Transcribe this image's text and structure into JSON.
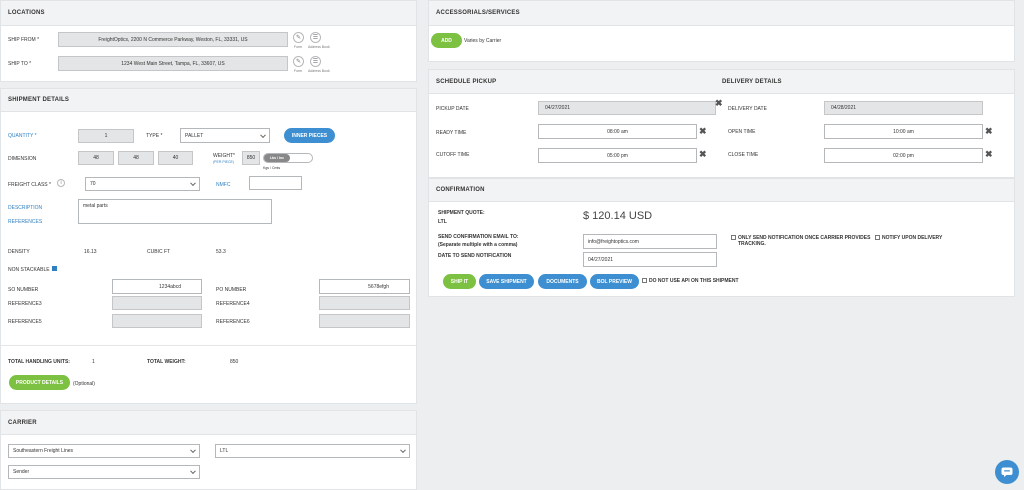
{
  "locations": {
    "title": "LOCATIONS",
    "ship_from_label": "SHIP FROM *",
    "ship_from_value": "FreightOptics, 2200 N Commerce Parkway, Weston, FL, 33331, US",
    "ship_to_label": "SHIP TO *",
    "ship_to_value": "1234 West Main Street, Tampa, FL, 33607, US",
    "form_label": "Form",
    "address_book_label": "Address Book"
  },
  "shipment": {
    "title": "SHIPMENT DETAILS",
    "quantity_label": "QUANTITY *",
    "quantity_value": "1",
    "type_label": "TYPE *",
    "type_value": "PALLET",
    "inner_pieces_button": "INNER PIECES",
    "dimension_label": "DIMENSION",
    "dim_l": "48",
    "dim_w": "48",
    "dim_h": "40",
    "weight_label": "WEIGHT*",
    "weight_sub": "(PER PIECE)",
    "weight_value": "850",
    "weight_unit_toggle": "Lbs / Inc",
    "weight_unit_alt": "Kgs / Cmts",
    "freight_class_label": "FREIGHT CLASS *",
    "freight_class_value": "70",
    "nmfc_label": "NMFC",
    "nmfc_value": "",
    "description_label": "DESCRIPTION",
    "description_value": "metal parts",
    "references_label": "REFERENCES",
    "density_label": "DENSITY",
    "density_value": "16.13",
    "cubic_ft_label": "CUBIC FT",
    "cubic_ft_value": "53.3",
    "non_stackable_label": "NON STACKABLE",
    "so_number_label": "SO NUMBER",
    "so_number_value": "1234abcd",
    "po_number_label": "PO NUMBER",
    "po_number_value": "5678efgh",
    "reference3_label": "REFERENCE3",
    "reference4_label": "REFERENCE4",
    "reference5_label": "REFERENCE5",
    "reference6_label": "REFERENCE6",
    "total_units_label": "TOTAL HANDLING UNITS:",
    "total_units_value": "1",
    "total_weight_label": "TOTAL WEIGHT:",
    "total_weight_value": "850",
    "product_details_button": "PRODUCT DETAILS",
    "optional_label": "(Optional)"
  },
  "carrier": {
    "title": "CARRIER",
    "carrier_value": "Southeastern Freight Lines",
    "mode_value": "LTL",
    "party_value": "Sender"
  },
  "accessorials": {
    "title": "ACCESSORIALS/SERVICES",
    "add_button": "ADD",
    "note": "Varies by Carrier"
  },
  "pickup": {
    "title": "SCHEDULE PICKUP",
    "pickup_date_label": "PICKUP DATE",
    "pickup_date_value": "04/27/2021",
    "ready_time_label": "READY TIME",
    "ready_time_value": "08:00 am",
    "cutoff_time_label": "CUTOFF TIME",
    "cutoff_time_value": "05:00 pm"
  },
  "delivery": {
    "title": "DELIVERY DETAILS",
    "delivery_date_label": "DELIVERY DATE",
    "delivery_date_value": "04/28/2021",
    "open_time_label": "OPEN TIME",
    "open_time_value": "10:00 am",
    "close_time_label": "CLOSE TIME",
    "close_time_value": "02:00 pm"
  },
  "confirmation": {
    "title": "CONFIRMATION",
    "quote_label": "SHIPMENT QUOTE:",
    "quote_mode": "LTL",
    "quote_value": "$ 120.14 USD",
    "email_label": "SEND CONFIRMATION EMAIL TO:",
    "email_sub": "(Separate multiple with a comma)",
    "email_value": "info@freightoptics.com",
    "date_notify_label": "DATE TO SEND NOTIFICATION",
    "date_notify_value": "04/27/2021",
    "only_send_label": "ONLY SEND NOTIFICATION ONCE CARRIER PROVIDES TRACKING.",
    "notify_delivery_label": "NOTIFY UPON DELIVERY",
    "ship_it_button": "SHIP IT",
    "save_shipment_button": "SAVE SHIPMENT",
    "documents_button": "DOCUMENTS",
    "bol_preview_button": "BOL PREVIEW",
    "no_api_label": "DO NOT USE API ON THIS SHIPMENT"
  }
}
